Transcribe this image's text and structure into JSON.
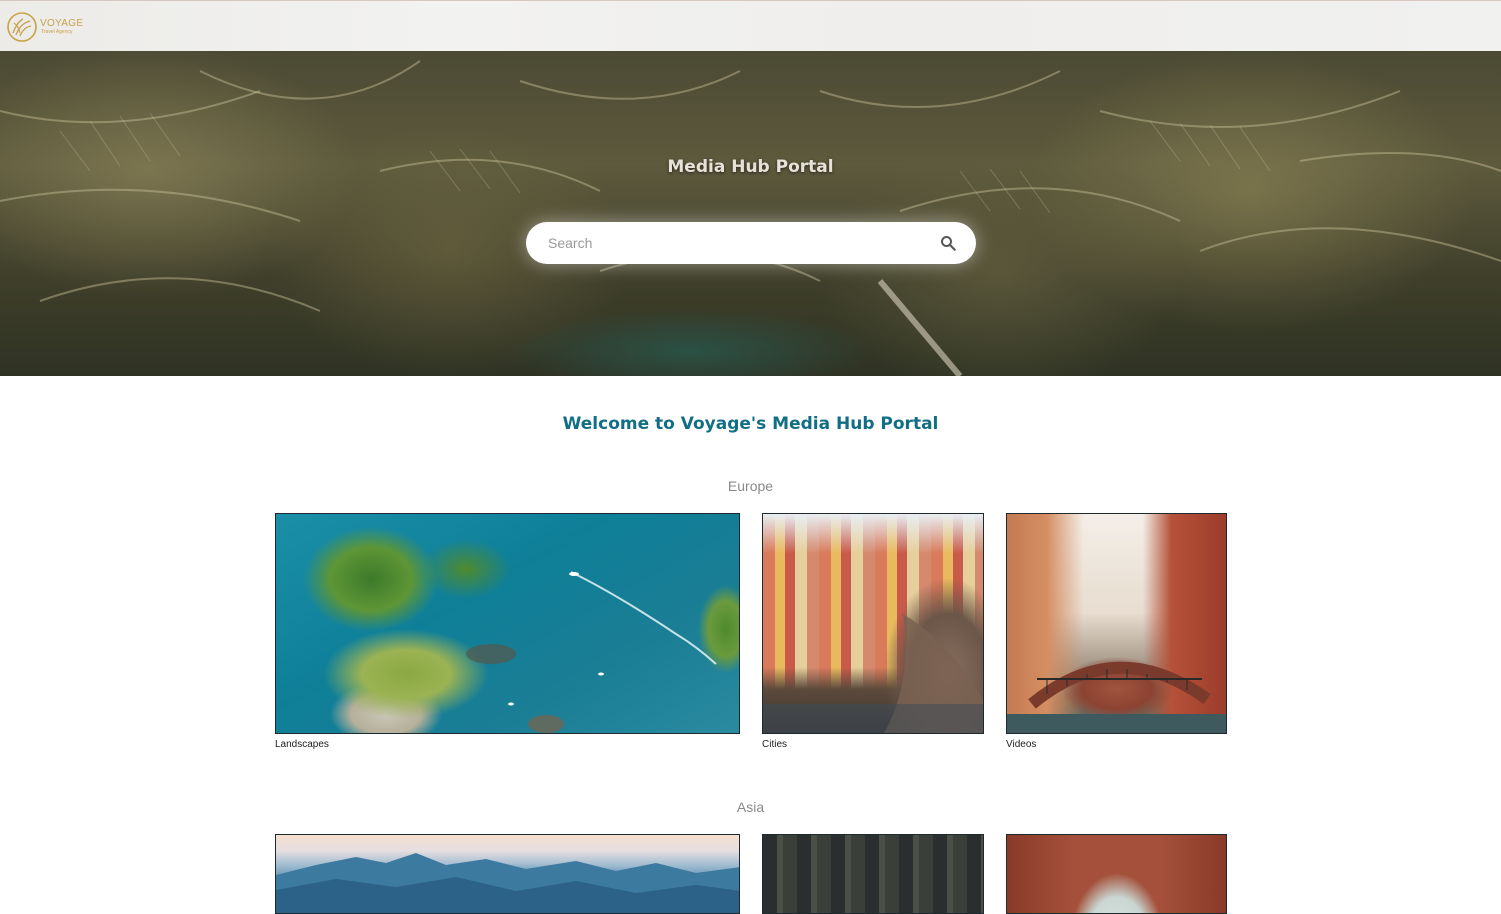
{
  "brand": {
    "name": "VOYAGE",
    "tagline": "Travel Agency"
  },
  "hero": {
    "title": "Media Hub Portal",
    "search_placeholder": "Search"
  },
  "welcome": "Welcome to Voyage's Media Hub Portal",
  "sections": [
    {
      "region": "Europe",
      "tiles": [
        {
          "caption": "Landscapes",
          "image": "aerial-coast-photo"
        },
        {
          "caption": "Cities",
          "image": "cliffside-village-photo"
        },
        {
          "caption": "Videos",
          "image": "canal-bridge-photo"
        }
      ]
    },
    {
      "region": "Asia",
      "tiles": [
        {
          "caption": "",
          "image": "great-wall-photo"
        },
        {
          "caption": "",
          "image": "alley-photo"
        },
        {
          "caption": "",
          "image": "archway-photo"
        }
      ]
    }
  ],
  "colors": {
    "welcome_text": "#126e84",
    "logo_gold": "#c9a24a",
    "region_text": "#8a8a8a"
  },
  "icons": {
    "search": "search-icon",
    "logo": "voyage-logo-icon"
  }
}
